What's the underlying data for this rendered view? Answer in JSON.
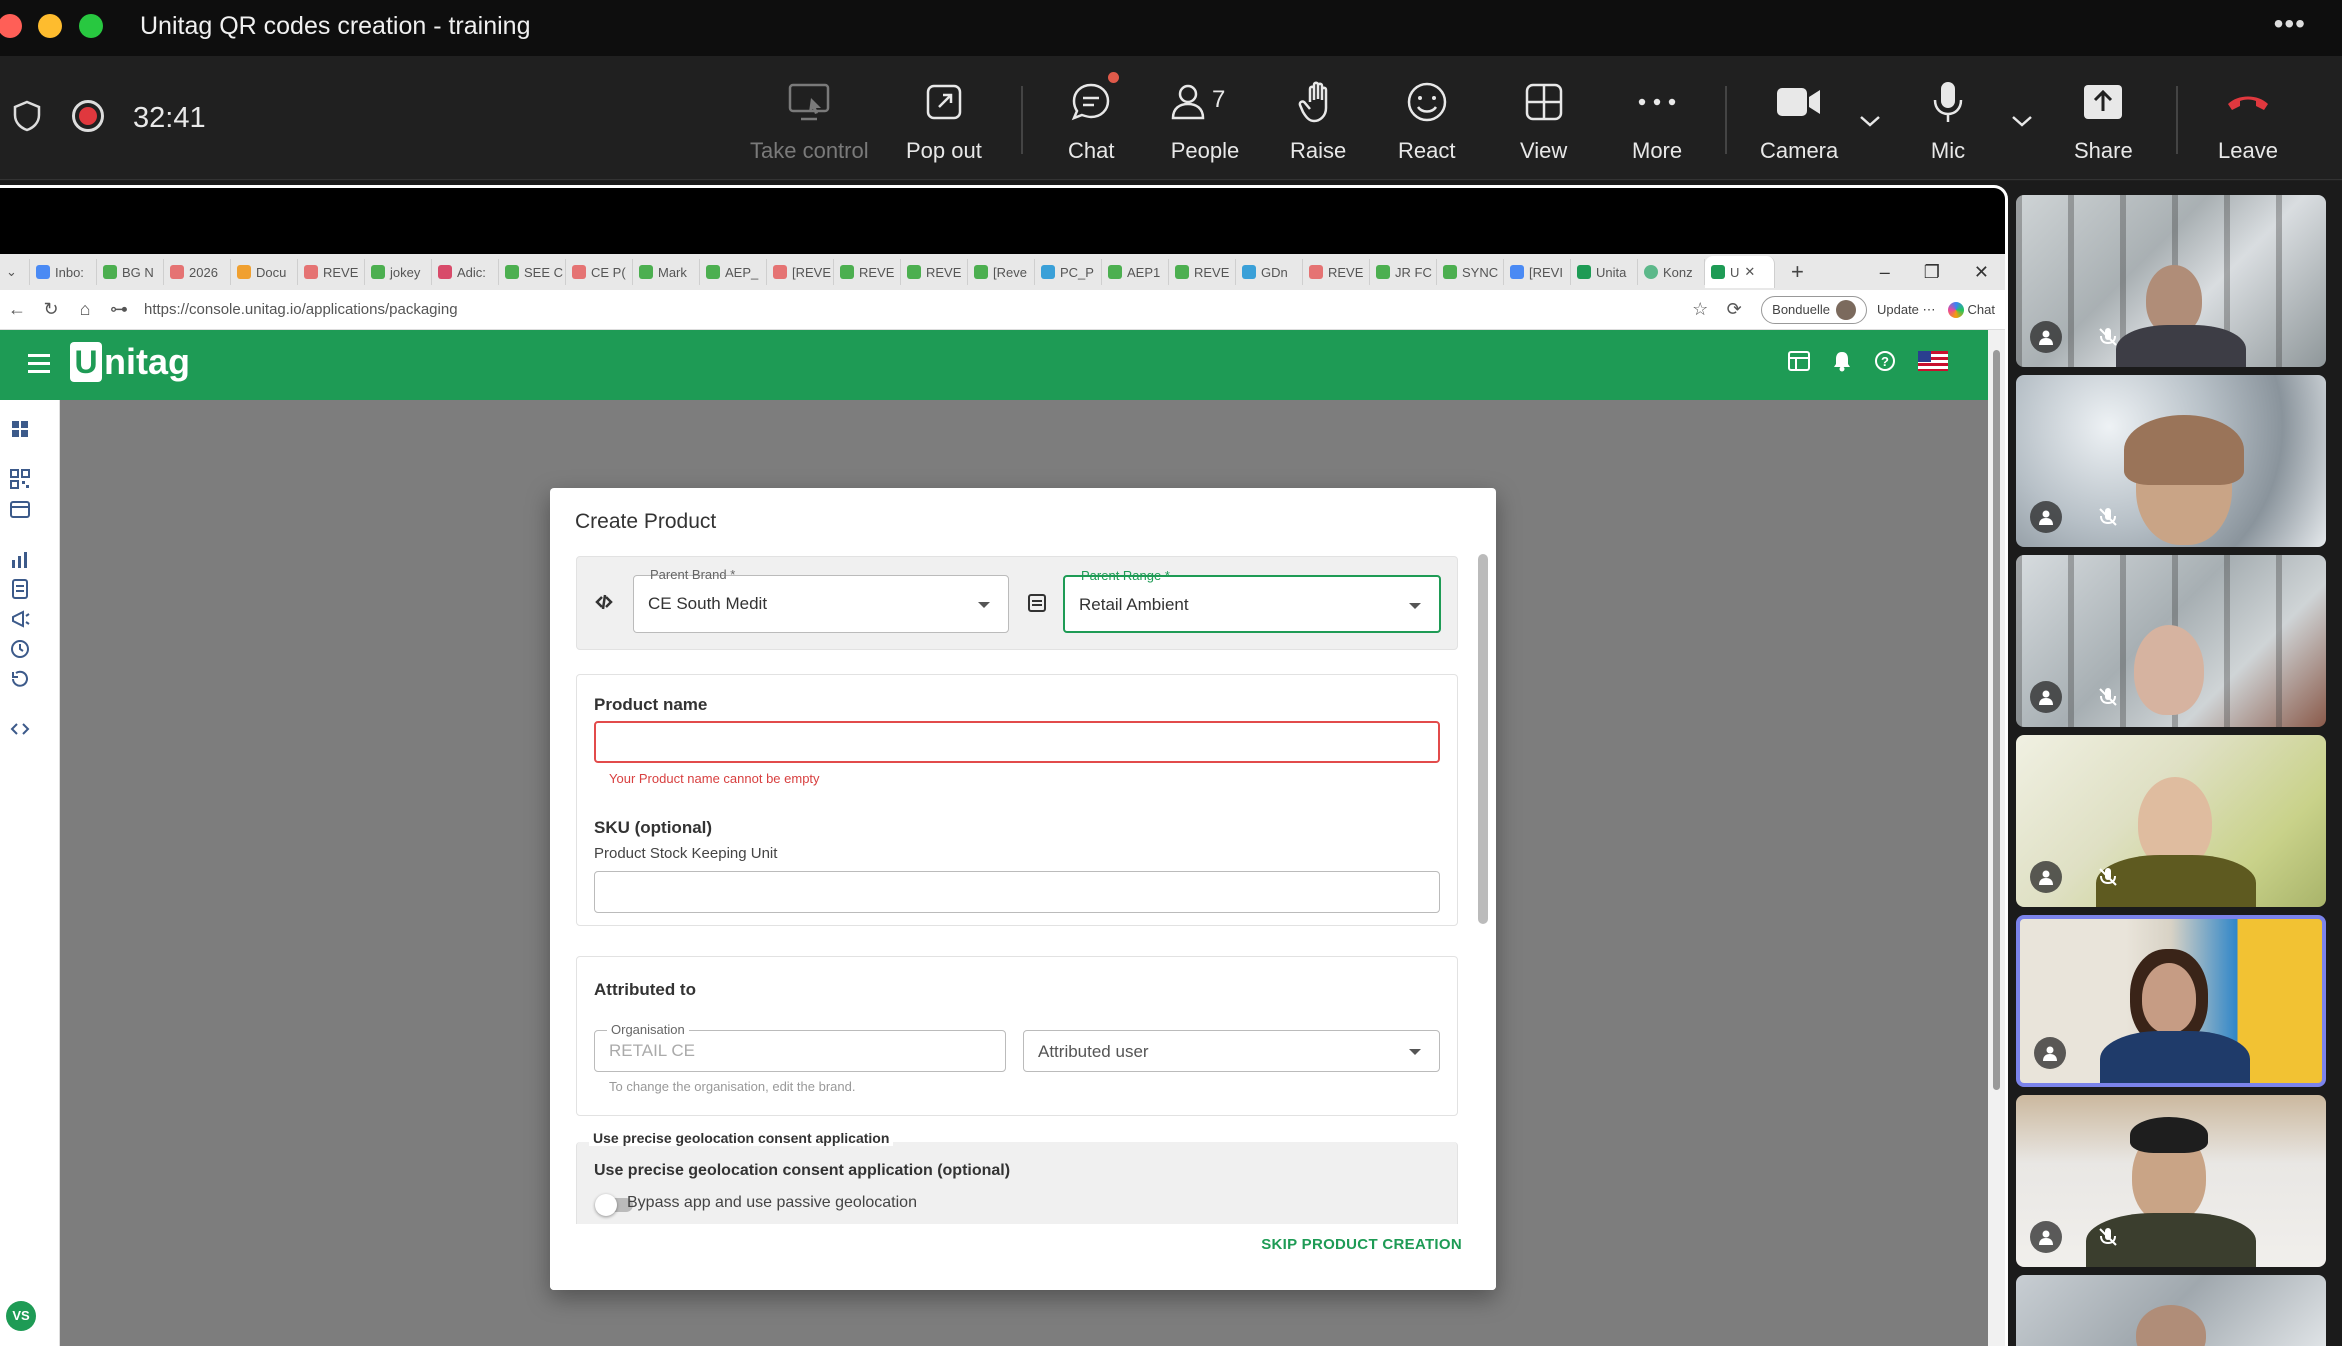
{
  "window": {
    "title": "Unitag QR codes creation - training",
    "more": "•••"
  },
  "meeting": {
    "timer": "32:41",
    "buttons": {
      "take_control": "Take control",
      "pop_out": "Pop out",
      "chat": "Chat",
      "people": "People",
      "people_count": "7",
      "raise": "Raise",
      "react": "React",
      "view": "View",
      "more": "More",
      "camera": "Camera",
      "mic": "Mic",
      "share": "Share",
      "leave": "Leave"
    }
  },
  "browser": {
    "tabs": [
      "Inbo:",
      "BG N",
      "2026",
      "Docu",
      "REVE",
      "jokey",
      "Adic:",
      "SEE C",
      "CE P(",
      "Mark",
      "AEP_",
      "[REVE",
      "REVE",
      "REVE",
      "[Reve",
      "PC_P",
      "AEP1",
      "REVE",
      "GDn",
      "REVE",
      "JR FC",
      "SYNC",
      "[REVI",
      "Unita",
      "Konz",
      "U"
    ],
    "active_tab": "U",
    "new_tab": "+",
    "url": "https://console.unitag.io/applications/packaging",
    "profile": "Bonduelle",
    "update": "Update ⋯",
    "chat": "Chat"
  },
  "app": {
    "logo_text": "nitag",
    "logo_mark": "U",
    "user_initials": "VS"
  },
  "modal": {
    "title": "Create Product",
    "parent_brand_label": "Parent Brand *",
    "parent_brand_value": "CE South Medit",
    "parent_range_label": "Parent Range *",
    "parent_range_value": "Retail Ambient",
    "product_name_label": "Product name",
    "product_name_value": "",
    "product_name_error": "Your Product name cannot be empty",
    "sku_label": "SKU (optional)",
    "sku_sublabel": "Product Stock Keeping Unit",
    "sku_value": "",
    "attributed_label": "Attributed to",
    "organisation_label": "Organisation",
    "organisation_value": "RETAIL CE",
    "organisation_hint": "To change the organisation, edit the brand.",
    "attributed_user_placeholder": "Attributed user",
    "geo_legend": "Use precise geolocation consent application",
    "geo_title": "Use precise geolocation consent application (optional)",
    "geo_toggle_label": "Bypass app and use passive geolocation",
    "skip_label": "SKIP PRODUCT CREATION"
  },
  "colors": {
    "brand_green": "#1e9b55",
    "error_red": "#e24b4b",
    "leave_red": "#e0383e",
    "active_tile": "#7b83eb"
  }
}
